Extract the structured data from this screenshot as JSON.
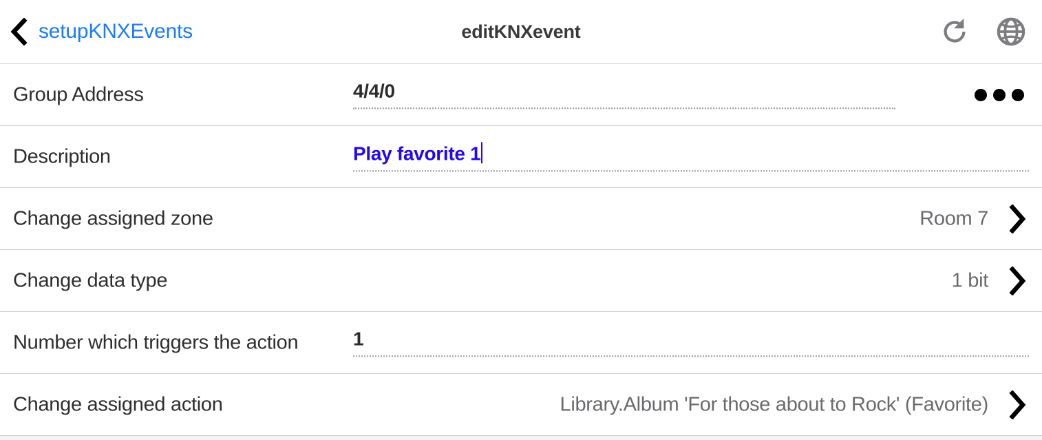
{
  "header": {
    "back_label": "setupKNXEvents",
    "title": "editKNXevent",
    "back_icon": "chevron-left-icon",
    "refresh_icon": "refresh-icon",
    "globe_icon": "globe-icon"
  },
  "rows": [
    {
      "label": "Group Address",
      "value": "4/4/0",
      "type": "text-input",
      "accessory": "ellipsis-menu"
    },
    {
      "label": "Description",
      "value": "Play favorite 1",
      "type": "text-input",
      "accessory": "caret",
      "focused": true
    },
    {
      "label": "Change assigned zone",
      "value": "Room 7",
      "type": "disclosure",
      "accessory": "chevron-right-icon"
    },
    {
      "label": "Change data type",
      "value": "1 bit",
      "type": "disclosure",
      "accessory": "chevron-right-icon"
    },
    {
      "label": "Number which triggers the action",
      "value": "1",
      "type": "text-input",
      "accessory": "none"
    },
    {
      "label": "Change assigned action",
      "value": "Library.Album 'For those about to Rock' (Favorite)",
      "type": "disclosure",
      "accessory": "chevron-right-icon"
    }
  ],
  "colors": {
    "link_blue": "#1a7cf7",
    "input_blue": "#2308ef",
    "label_dark": "#2e2e30",
    "value_gray": "#6a6a6e",
    "separator": "#cfcfd2",
    "icon_gray": "#7d7d81"
  }
}
